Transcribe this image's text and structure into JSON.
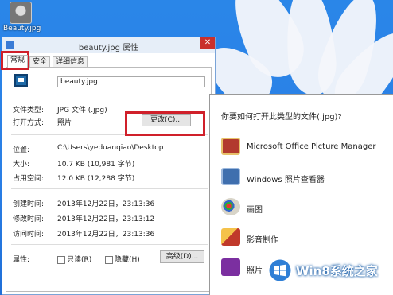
{
  "desktop": {
    "icon_label": "Beauty.jpg"
  },
  "dialog": {
    "title": "beauty.jpg 属性",
    "close_glyph": "✕",
    "tabs": [
      "常规",
      "安全",
      "详细信息"
    ],
    "filename": "beauty.jpg",
    "rows": {
      "type_label": "文件类型:",
      "type_value": "JPG 文件 (.jpg)",
      "open_label": "打开方式:",
      "open_value": "照片",
      "change_button": "更改(C)...",
      "location_label": "位置:",
      "location_value": "C:\\Users\\yeduanqiao\\Desktop",
      "size_label": "大小:",
      "size_value": "10.7 KB (10,981 字节)",
      "disk_label": "占用空间:",
      "disk_value": "12.0 KB (12,288 字节)",
      "created_label": "创建时间:",
      "created_value": "2013年12月22日，23:13:36",
      "modified_label": "修改时间:",
      "modified_value": "2013年12月22日，23:13:12",
      "accessed_label": "访问时间:",
      "accessed_value": "2013年12月22日，23:13:36",
      "attr_label": "属性:",
      "readonly_label": "只读(R)",
      "hidden_label": "隐藏(H)",
      "advanced_button": "高级(D)..."
    }
  },
  "chooser": {
    "title": "你要如何打开此类型的文件(.jpg)?",
    "apps": [
      {
        "label": "Microsoft Office Picture Manager",
        "icon": "picture-manager-icon",
        "color": "#b23a2e"
      },
      {
        "label": "Windows 照片查看器",
        "icon": "photo-viewer-icon",
        "color": "#3f6fae"
      },
      {
        "label": "画图",
        "icon": "paint-icon",
        "color": "#d8d4c8"
      },
      {
        "label": "影音制作",
        "icon": "movie-maker-icon",
        "color": "#c0392b"
      },
      {
        "label": "照片",
        "icon": "photos-icon",
        "color": "#7b2fa0"
      }
    ]
  },
  "watermark": {
    "text": "Win8系统之家"
  },
  "colors": {
    "highlight": "#d0202a",
    "accent": "#2a86e8"
  }
}
